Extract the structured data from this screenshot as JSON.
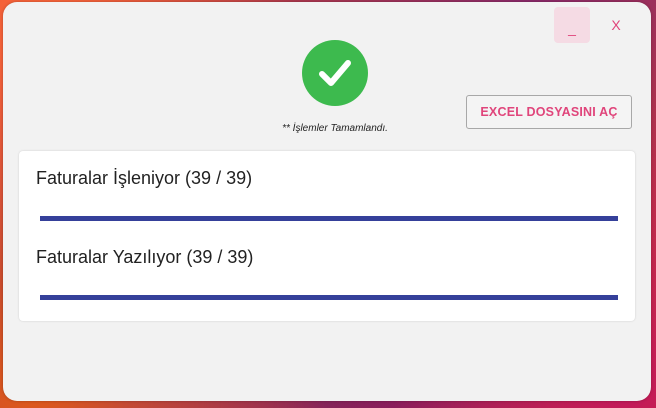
{
  "window": {
    "minimize_label": "_",
    "close_label": "X"
  },
  "status": {
    "icon": "check-circle-icon",
    "text": "** İşlemler Tamamlandı."
  },
  "excel_button": {
    "label": "EXCEL DOSYASINI AÇ"
  },
  "progress": [
    {
      "label": "Faturalar İşleniyor (39 / 39)",
      "value": 1.0
    },
    {
      "label": "Faturalar Yazılıyor (39 / 39)",
      "value": 1.0
    }
  ],
  "colors": {
    "accent": "#e0457b",
    "success": "#3dba4e",
    "progress_fill": "#35409a",
    "window_bg": "#f2f2f2"
  }
}
